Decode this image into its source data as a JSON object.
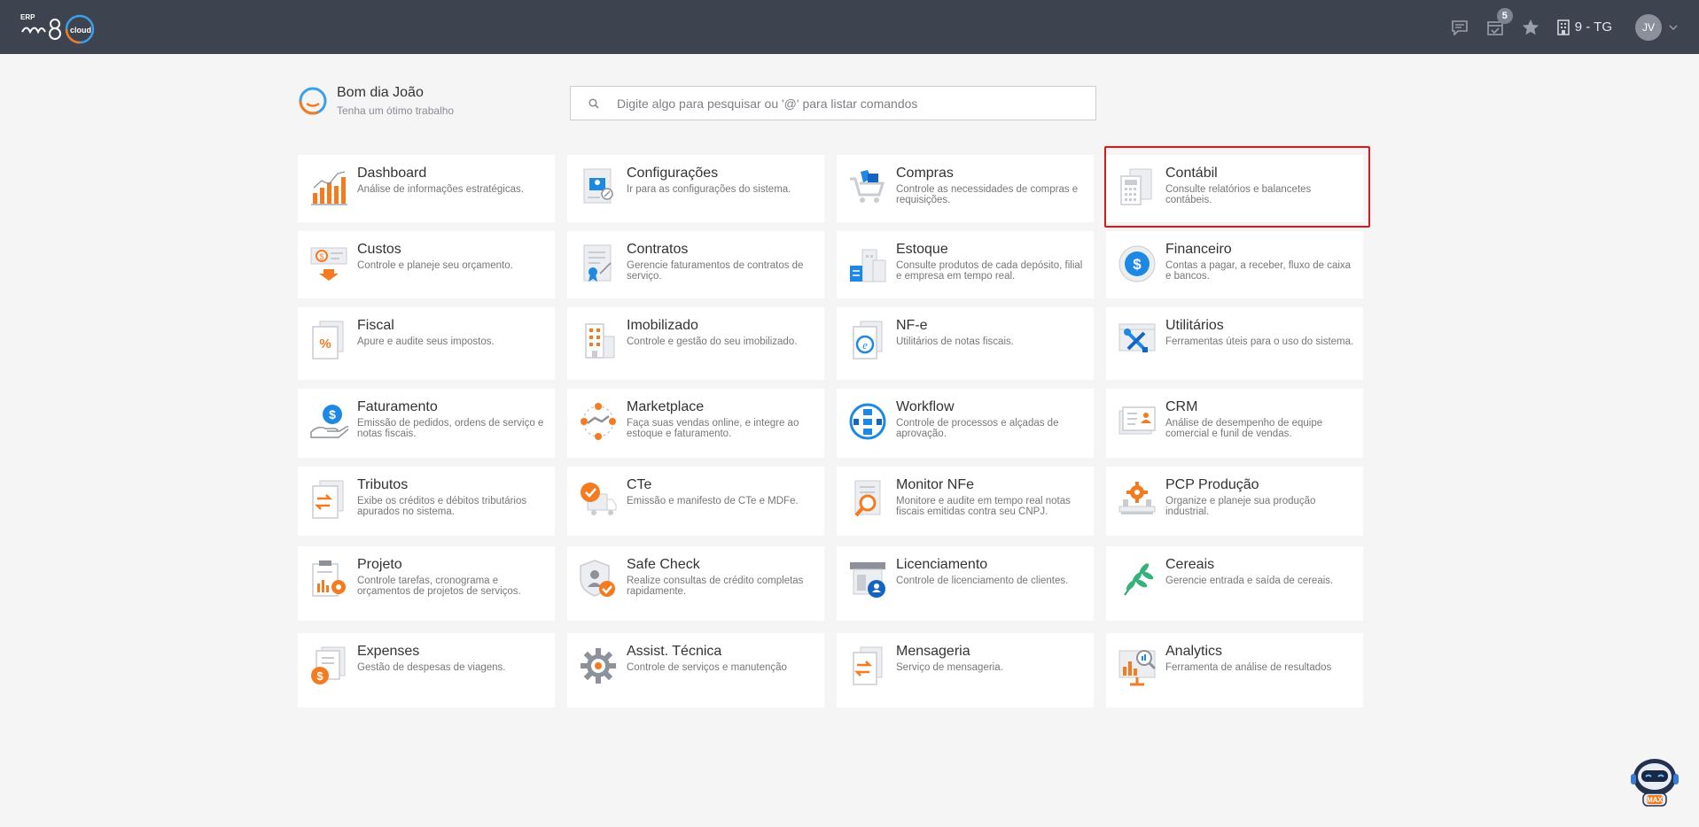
{
  "header": {
    "logo_text": "ERP m8 cloud",
    "notification_count": "5",
    "company": "9 - TG",
    "user_initials": "JV"
  },
  "greeting": {
    "title": "Bom dia João",
    "subtitle": "Tenha um ótimo trabalho"
  },
  "search": {
    "placeholder": "Digite algo para pesquisar ou '@' para listar comandos"
  },
  "modules": [
    {
      "title": "Dashboard",
      "desc": "Análise de informações estratégicas.",
      "icon": "bar-chart-icon"
    },
    {
      "title": "Configurações",
      "desc": "Ir para as configurações do sistema.",
      "icon": "settings-doc-icon"
    },
    {
      "title": "Compras",
      "desc": "Controle as necessidades de compras e requisições.",
      "icon": "shopping-cart-icon"
    },
    {
      "title": "Contábil",
      "desc": "Consulte relatórios e balancetes contábeis.",
      "icon": "calculator-icon"
    },
    {
      "title": "Custos",
      "desc": "Controle e planeje seu orçamento.",
      "icon": "cost-money-icon"
    },
    {
      "title": "Contratos",
      "desc": "Gerencie faturamentos de contratos de serviço.",
      "icon": "contract-icon"
    },
    {
      "title": "Estoque",
      "desc": "Consulte produtos de cada depósito, filial e empresa em tempo real.",
      "icon": "warehouse-icon"
    },
    {
      "title": "Financeiro",
      "desc": "Contas a pagar, a receber, fluxo de caixa e bancos.",
      "icon": "dollar-circle-icon"
    },
    {
      "title": "Fiscal",
      "desc": "Apure e audite seus impostos.",
      "icon": "percent-doc-icon"
    },
    {
      "title": "Imobilizado",
      "desc": "Controle e gestão do seu imobilizado.",
      "icon": "building-icon"
    },
    {
      "title": "NF-e",
      "desc": "Utilitários de notas fiscais.",
      "icon": "nfe-doc-icon"
    },
    {
      "title": "Utilitários",
      "desc": "Ferramentas úteis para o uso do sistema.",
      "icon": "tools-icon"
    },
    {
      "title": "Faturamento",
      "desc": "Emissão de pedidos, ordens de serviço e notas fiscais.",
      "icon": "billing-hand-icon"
    },
    {
      "title": "Marketplace",
      "desc": "Faça suas vendas online, e integre ao estoque e faturamento.",
      "icon": "handshake-icon"
    },
    {
      "title": "Workflow",
      "desc": "Controle de processos e alçadas de aprovação.",
      "icon": "workflow-icon"
    },
    {
      "title": "CRM",
      "desc": "Análise de desempenho de equipe comercial e funil de vendas.",
      "icon": "crm-card-icon"
    },
    {
      "title": "Tributos",
      "desc": "Exibe os créditos e débitos tributários apurados no sistema.",
      "icon": "tax-arrows-icon"
    },
    {
      "title": "CTe",
      "desc": "Emissão e manifesto de CTe e MDFe.",
      "icon": "truck-icon"
    },
    {
      "title": "Monitor NFe",
      "desc": "Monitore e audite em tempo real notas fiscais emitidas contra seu CNPJ.",
      "icon": "magnifier-doc-icon"
    },
    {
      "title": "PCP Produção",
      "desc": "Organize e planeje sua produção industrial.",
      "icon": "production-gear-icon"
    },
    {
      "title": "Projeto",
      "desc": "Controle tarefas, cronograma e orçamentos de projetos de serviços.",
      "icon": "project-clipboard-icon"
    },
    {
      "title": "Safe Check",
      "desc": "Realize consultas de crédito completas rapidamente.",
      "icon": "shield-check-icon"
    },
    {
      "title": "Licenciamento",
      "desc": "Controle de licenciamento de clientes.",
      "icon": "license-store-icon"
    },
    {
      "title": "Cereais",
      "desc": "Gerencie entrada e saída de cereais.",
      "icon": "leaf-icon"
    },
    {
      "title": "Expenses",
      "desc": "Gestão de despesas de viagens.",
      "icon": "expense-coin-icon"
    },
    {
      "title": "Assist. Técnica",
      "desc": "Controle de serviços e manutenção",
      "icon": "gear-tool-icon"
    },
    {
      "title": "Mensageria",
      "desc": "Serviço de mensageria.",
      "icon": "message-doc-icon"
    },
    {
      "title": "Analytics",
      "desc": "Ferramenta de análise de resultados",
      "icon": "analytics-screen-icon"
    }
  ],
  "assistant": {
    "label": "MAX"
  }
}
